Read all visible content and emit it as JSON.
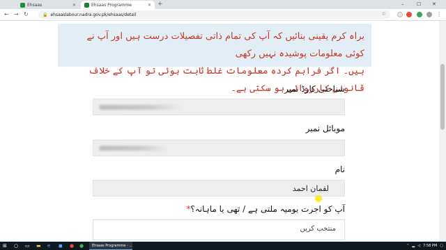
{
  "browser": {
    "tabs": [
      {
        "title": "Ehsaas",
        "active": false
      },
      {
        "title": "Ehsaas Programme",
        "active": true
      }
    ],
    "new_tab": "+",
    "window_controls": {
      "minimize": "–",
      "maximize": "☐",
      "close": "✕"
    },
    "url": "ehsaaslabour.nadra.gov.pk/ehsaas/detail"
  },
  "notice": {
    "line1": "براہ کرم یقینی بنائیں کہ آپ کی تمام ذاتی تفصیلات درست ہیں اور آپ نے کوئی معلومات پوشیدہ نہیں رکھی",
    "line2": "ہیں۔ اگر فراہم کردہ معلومات غلط ثابت ہوئی تو آپ کے خلاف قانونی کارروائی ہو سکتی ہے۔"
  },
  "form": {
    "cnic_label": "شناختی کارڈ نمبر",
    "mobile_label": "موبائل نمبر",
    "name_label": "نام",
    "name_value": "لقمان احمد",
    "wage_label": "آپ کو اجرت یومیہ ملتی ہے / تھی یا ماہانہ؟",
    "required_mark": "*",
    "wage_select_placeholder": "منتخب کریں"
  },
  "taskbar": {
    "app_title": "Ehsaas Programme - ...",
    "time": "7:58 PM"
  },
  "colors": {
    "notice_bg": "#e3edf5",
    "notice_text": "#c0392b",
    "field_bg": "#eeeeee",
    "taskbar_bg": "#101820"
  }
}
